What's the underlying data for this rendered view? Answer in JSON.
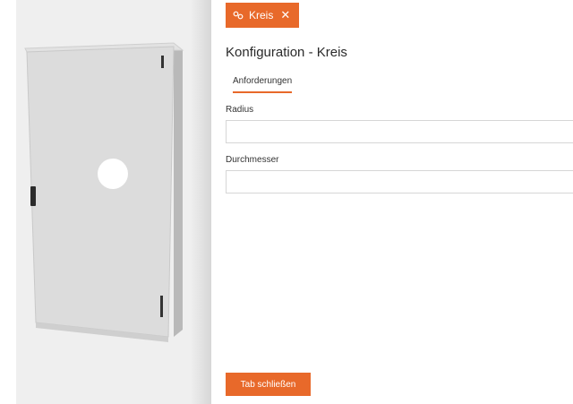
{
  "tab": {
    "label": "Kreis",
    "icon": "shape-link-icon",
    "close_icon": "close-icon"
  },
  "header": {
    "title": "Konfiguration - Kreis"
  },
  "subtabs": [
    {
      "label": "Anforderungen",
      "active": true
    }
  ],
  "fields": [
    {
      "label": "Radius",
      "value": "",
      "placeholder": ""
    },
    {
      "label": "Durchmesser",
      "value": "",
      "placeholder": ""
    }
  ],
  "footer": {
    "close_label": "Tab schließen"
  },
  "colors": {
    "accent": "#e8692a"
  }
}
